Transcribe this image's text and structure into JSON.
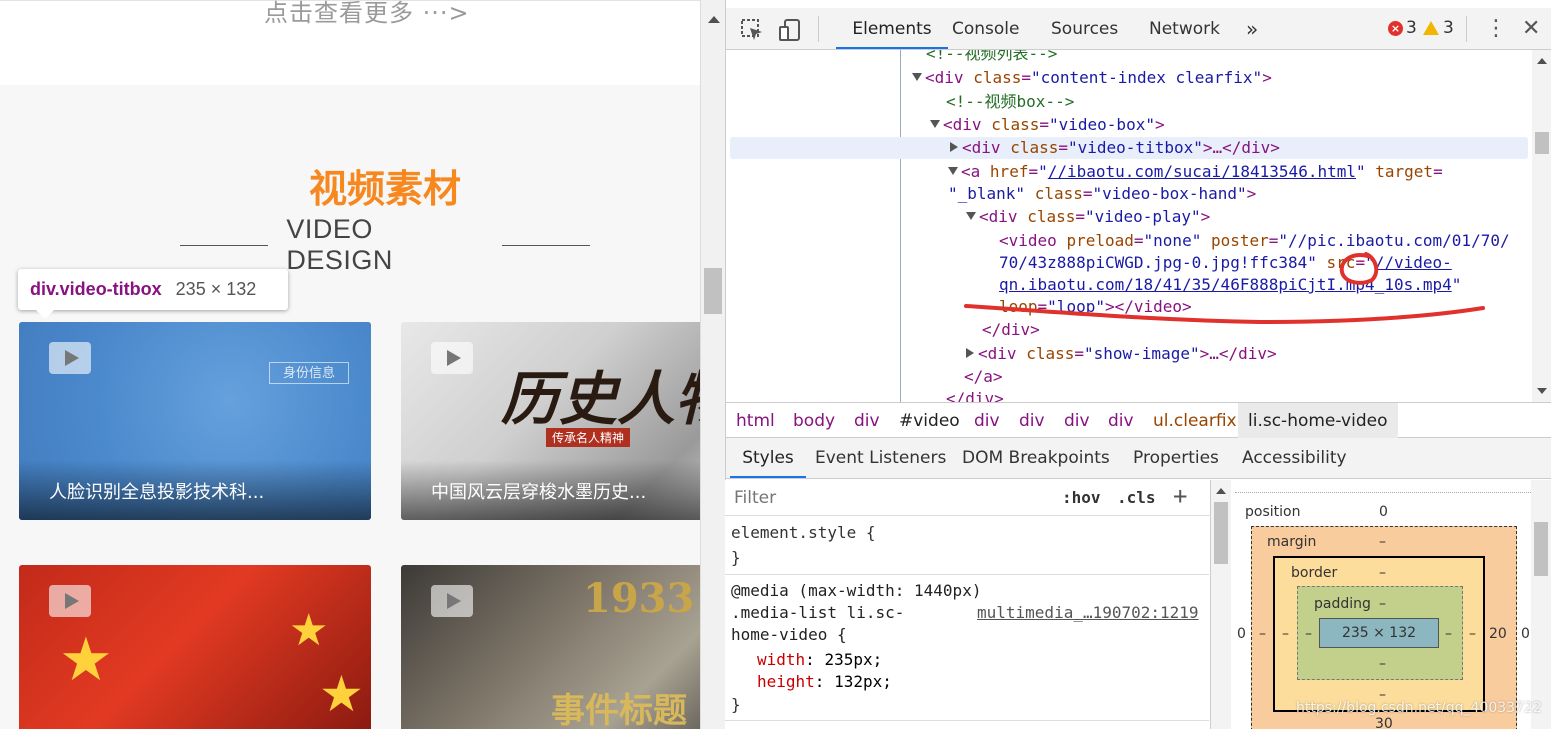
{
  "page": {
    "more_link": "点击查看更多 ···>",
    "section_title": "视频素材",
    "section_subtitle": "VIDEO DESIGN",
    "tooltip": {
      "tag": "div.video-titbox",
      "dims": "235 × 132"
    },
    "cards": [
      {
        "caption": "人脸识别全息投影技术科...",
        "deco": "身份信息"
      },
      {
        "caption": "中国风云层穿梭水墨历史...",
        "big": "历史人物",
        "subline": "传承名人精神"
      },
      {
        "caption": ""
      },
      {
        "caption": "",
        "year": "1933",
        "year2": "事件标题"
      }
    ]
  },
  "devtools": {
    "tabs": [
      "Elements",
      "Console",
      "Sources",
      "Network"
    ],
    "more_tabs": "»",
    "errors": "3",
    "warnings": "3",
    "dom": {
      "l1": "<!--视频列表-->",
      "l2_tag": "div",
      "l2_attr": "class",
      "l2_val": "\"content-index clearfix\"",
      "l3": "<!--视频box-->",
      "l4_tag": "div",
      "l4_attr": "class",
      "l4_val": "\"video-box\"",
      "l5_tag": "div",
      "l5_attr": "class",
      "l5_val": "\"video-titbox\"",
      "l5_end": ">…</div>",
      "l6_tag": "a",
      "l6_attr": "href",
      "l6_href": "//ibaotu.com/sucai/18413546.html",
      "l6_attr2": "target",
      "l7_val": "\"_blank\"",
      "l7_attr": "class",
      "l7_val2": "\"video-box-hand\"",
      "l8_tag": "div",
      "l8_attr": "class",
      "l8_val": "\"video-play\"",
      "l9_tag": "video",
      "l9_attr": "preload",
      "l9_val": "\"none\"",
      "l9_attr2": "poster",
      "l9_val2": "\"//pic.ibaotu.com/01/70/",
      "l10_val": "70/43z888piCWGD.jpg-0.jpg!ffc384\"",
      "l10_attr": "src",
      "l10_link": "//video-",
      "l11_link": "qn.ibaotu.com/18/41/35/46F888piCjtI.mp4_10s.mp4",
      "l12_attr": "loop",
      "l12_val": "\"loop\"",
      "l12_end": "></video>",
      "l13": "</div>",
      "l14_tag": "div",
      "l14_attr": "class",
      "l14_val": "\"show-image\"",
      "l14_end": ">…</div>",
      "l15": "</a>",
      "l16": "</div>"
    },
    "breadcrumbs": [
      "html",
      "body",
      "div",
      "#video",
      "div",
      "div",
      "div",
      "div",
      "ul.clearfix",
      "li.sc-home-video"
    ],
    "sub_tabs": [
      "Styles",
      "Event Listeners",
      "DOM Breakpoints",
      "Properties",
      "Accessibility"
    ],
    "filter_placeholder": "Filter",
    "hov": ":hov",
    "cls": ".cls",
    "plus": "+",
    "styles": {
      "element_style": "element.style {",
      "close1": "}",
      "media": "@media (max-width: 1440px)",
      "selector1": ".media-list li.sc-",
      "source": "multimedia_…190702:1219",
      "selector2": "home-video {",
      "p1_name": "width",
      "p1_val": "235px;",
      "p2_name": "height",
      "p2_val": "132px;",
      "close2": "}"
    },
    "boxmodel": {
      "position_label": "position",
      "position_val": "0",
      "margin_label": "margin",
      "margin_top": "–",
      "border_label": "border",
      "border_top": "–",
      "padding_label": "padding",
      "padding_top": "–",
      "content": "235 × 132",
      "padding_bottom": "–",
      "border_bottom": "–",
      "left_outer": "0",
      "left_margin": "–",
      "left_border": "–",
      "left_padding": "–",
      "right_padding": "–",
      "right_border": "–",
      "right_margin": "20",
      "right_outer": "0",
      "bottom_margin": "30"
    },
    "watermark": "https://blog.csdn.net/qq_40033722"
  },
  "colors": {
    "accent": "#f7881f",
    "tab_active": "#1a73e8",
    "annotation": "#e0312c"
  }
}
